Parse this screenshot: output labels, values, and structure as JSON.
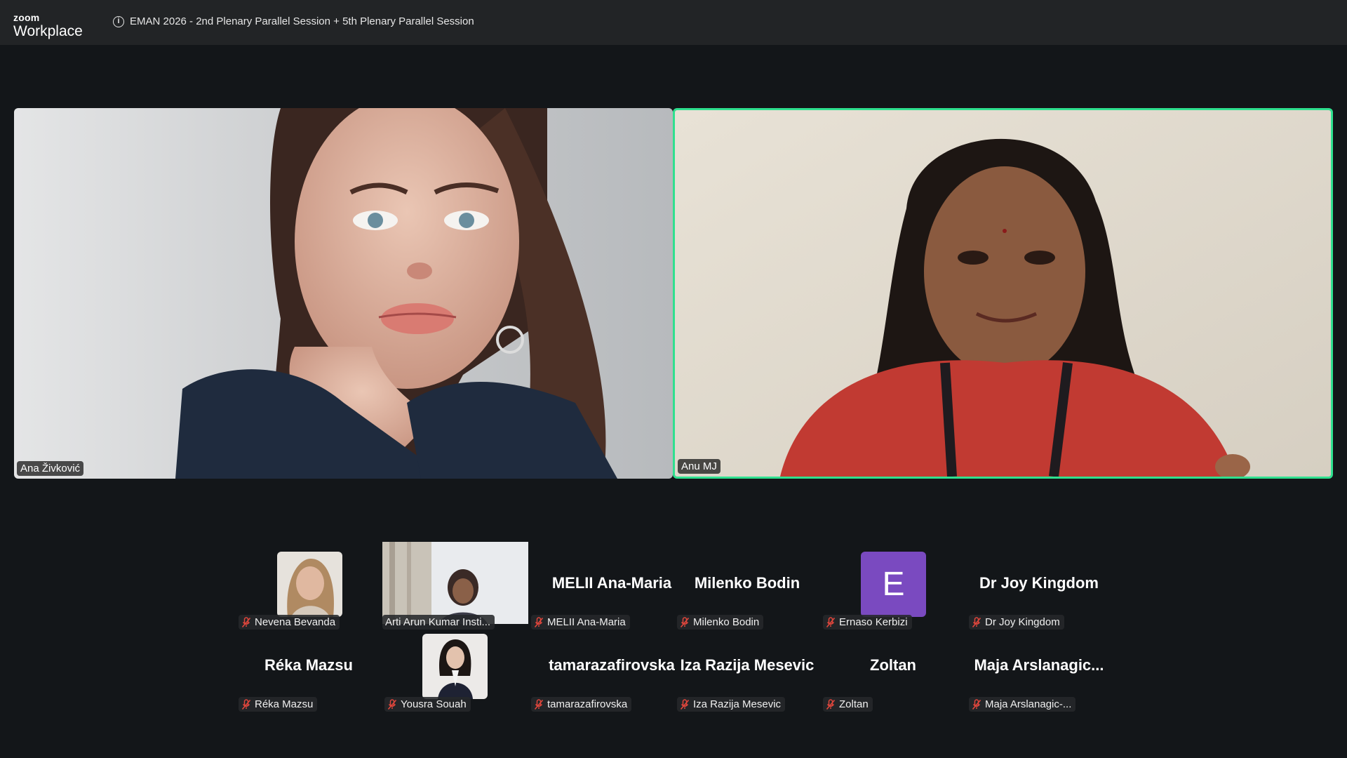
{
  "titlebar": {
    "logo_small": "zoom",
    "logo_big": "Workplace",
    "meeting_title": "EMAN 2026 - 2nd Plenary Parallel Session + 5th Plenary Parallel Session"
  },
  "speakers": [
    {
      "name": "Ana Živković"
    },
    {
      "name": "Anu MJ",
      "active_speaker": true
    }
  ],
  "gallery": [
    {
      "display": "photo",
      "label": "Nevena Bevanda",
      "muted": true
    },
    {
      "display": "video",
      "label": "Arti Arun Kumar Insti...",
      "muted": false
    },
    {
      "display": "name",
      "big_name": "MELII Ana-Maria",
      "label": "MELII Ana-Maria",
      "muted": true
    },
    {
      "display": "name",
      "big_name": "Milenko Bodin",
      "label": "Milenko Bodin",
      "muted": true
    },
    {
      "display": "letter",
      "letter": "E",
      "label": "Ernaso Kerbizi",
      "muted": true
    },
    {
      "display": "name",
      "big_name": "Dr Joy Kingdom",
      "label": "Dr Joy Kingdom",
      "muted": true
    },
    {
      "display": "name",
      "big_name": "Réka Mazsu",
      "label": "Réka Mazsu",
      "muted": true
    },
    {
      "display": "photo",
      "label": "Yousra Souah",
      "muted": true
    },
    {
      "display": "name",
      "big_name": "tamarazafirovska",
      "label": "tamarazafirovska",
      "muted": true
    },
    {
      "display": "name",
      "big_name": "Iza Razija Mesevic",
      "label": "Iza Razija Mesevic",
      "muted": true
    },
    {
      "display": "name",
      "big_name": "Zoltan",
      "label": "Zoltan",
      "muted": true
    },
    {
      "display": "name",
      "big_name": "Maja  Arslanagic...",
      "label": "Maja Arslanagic-...",
      "muted": true
    }
  ],
  "colors": {
    "active_speaker_border": "#2fe08f",
    "muted_icon": "#e0463c",
    "avatar_letter_bg": "#7a4ac0"
  }
}
